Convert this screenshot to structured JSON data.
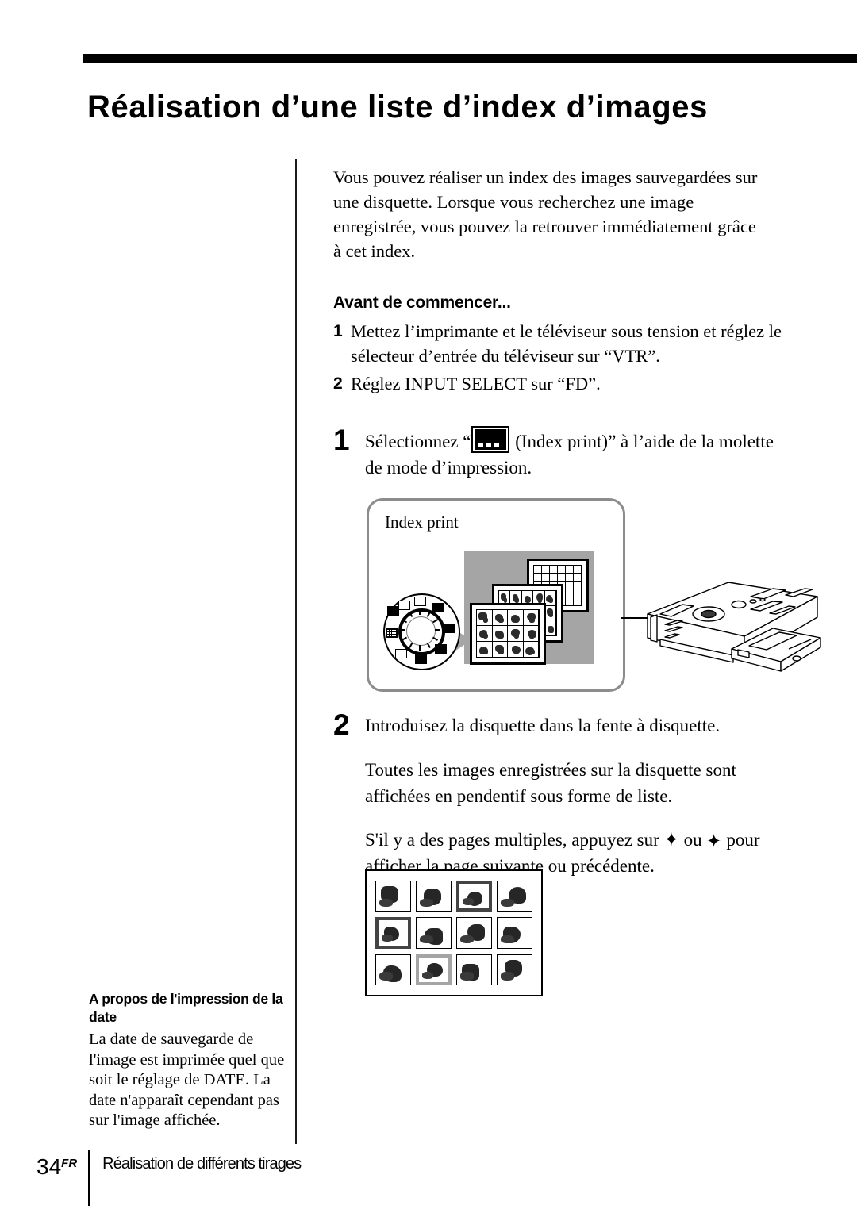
{
  "header": {
    "title": "Réalisation d’une liste d’index d’images"
  },
  "main": {
    "intro": "Vous pouvez réaliser un index des images sauvegardées sur une disquette. Lorsque vous recherchez une image enregistrée, vous pouvez la retrouver immédiatement grâce à cet index.",
    "before_heading": "Avant de commencer...",
    "before_steps": [
      {
        "num": "1",
        "text": "Mettez l’imprimante et le téléviseur sous tension et réglez le sélecteur d’entrée du téléviseur sur “VTR”."
      },
      {
        "num": "2",
        "text": "Réglez INPUT SELECT sur “FD”."
      }
    ],
    "step1": {
      "num": "1",
      "text_before_icon": "Sélectionnez “",
      "icon_name": "index-print-mode-icon",
      "text_after_icon": " (Index print)” à l’aide de la molette de mode d’impression."
    },
    "step2": {
      "num": "2",
      "text": "Introduisez la disquette dans la fente à disquette.",
      "paragraph1": "Toutes les images enregistrées sur la disquette sont affichées en pendentif sous forme de liste.",
      "paragraph2_part1": "S'il y a des pages multiples, appuyez sur ",
      "arrow_up": "✦",
      "paragraph2_part2": " ou ",
      "arrow_down": "✦",
      "paragraph2_part3": " pour afficher la page suivante ou précédente."
    }
  },
  "illustration": {
    "panel_label": "Index print",
    "dial_name": "print-mode-dial",
    "sheets_name": "index-print-sheets",
    "printer_name": "printer-device"
  },
  "thumbnails": {
    "rows": 3,
    "columns": 4,
    "selection": [
      "none",
      "none",
      "dark",
      "none",
      "dark",
      "none",
      "none",
      "none",
      "none",
      "gray",
      "none",
      "none"
    ]
  },
  "side_note": {
    "title": "A propos de l'impression de la date",
    "body": "La date de sauvegarde de l'image est imprimée quel que soit le réglage de DATE. La date n'apparaît cependant pas sur l'image affichée."
  },
  "footer": {
    "page_number": "34",
    "page_suffix": "FR",
    "section": "Réalisation de différents tirages"
  },
  "colors": {
    "ink": "#000000",
    "panel_border": "#8c8c8c",
    "gray_block": "#a5a5a5",
    "paper": "#ffffff"
  }
}
